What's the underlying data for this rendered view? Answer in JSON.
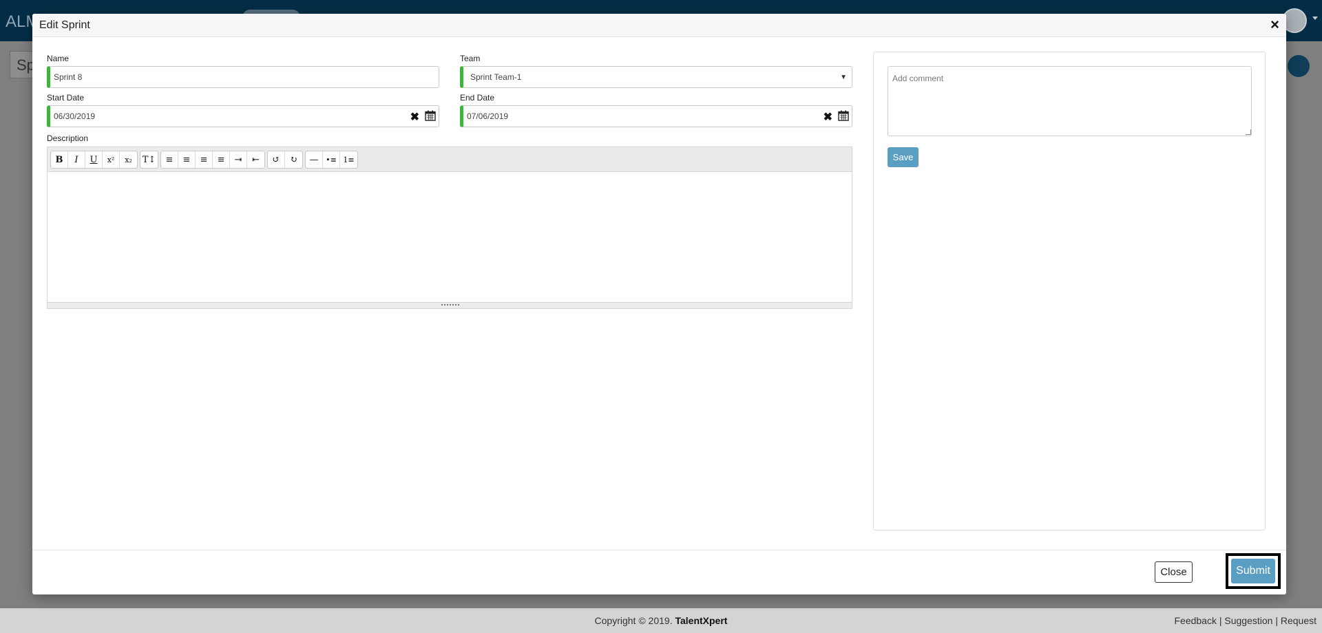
{
  "app": {
    "brand": "ALM",
    "page_title": "Sp"
  },
  "footer": {
    "copyright": "Copyright © 2019. ",
    "company": "TalentXpert",
    "links": "Feedback | Suggestion | Request"
  },
  "modal": {
    "title": "Edit Sprint",
    "close_icon": "×",
    "name_label": "Name",
    "name_value": "Sprint 8",
    "team_label": "Team",
    "team_value": "Sprint Team-1",
    "start_label": "Start Date",
    "start_value": "06/30/2019",
    "end_label": "End Date",
    "end_value": "07/06/2019",
    "description_label": "Description",
    "comment_placeholder": "Add comment",
    "save_label": "Save",
    "close_label": "Close",
    "submit_label": "Submit"
  },
  "toolbar": {
    "bold": "B",
    "italic": "I",
    "underline": "U",
    "superscript": "x²",
    "subscript": "x₂",
    "font_size": "T↕",
    "align_left": "≡",
    "align_center": "≡",
    "align_right": "≡",
    "justify": "≡",
    "indent": "⇥",
    "outdent": "⇤",
    "undo": "↺",
    "redo": "↻",
    "horizontal_rule": "—",
    "bullet_list": "•≡",
    "number_list": "1≡"
  },
  "colors": {
    "accent": "#5b9ec4",
    "valid_border": "#3db53d",
    "topbar": "#032d46"
  }
}
